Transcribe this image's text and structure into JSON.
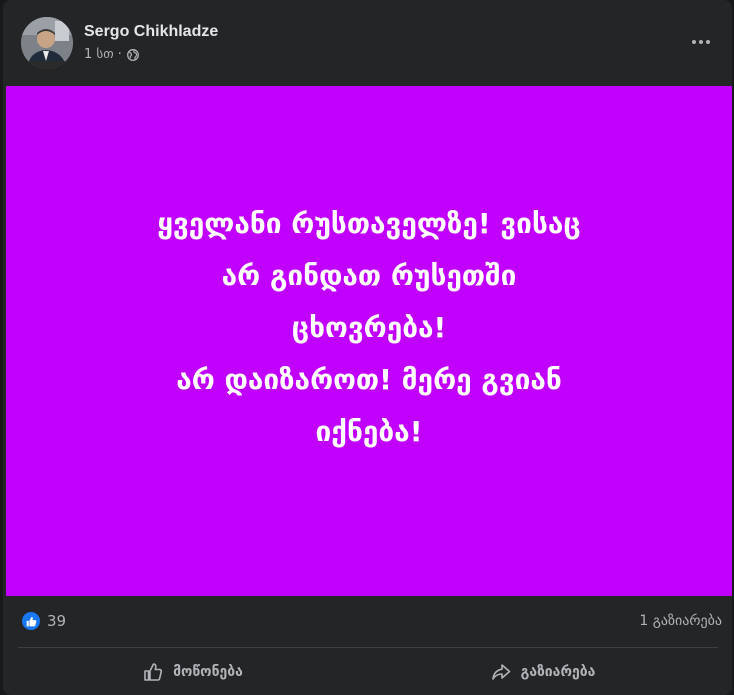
{
  "post": {
    "author": "Sergo Chikhladze",
    "timestamp": "1 სთ",
    "separator": "·",
    "privacy_icon": "globe-icon",
    "more_icon": "more-options-icon",
    "banner": {
      "background": "#c000fc",
      "text_color": "#ffffff",
      "lines": [
        "ყველანი რუსთაველზე! ვისაც",
        "არ გინდათ რუსეთში",
        "ცხოვრება!",
        "არ დაიზაროთ! მერე გვიან",
        "იქნება!"
      ]
    }
  },
  "stats": {
    "reaction_icon": "like-reaction-icon",
    "reactions_count": "39",
    "shares": "1 გაზიარება"
  },
  "actions": {
    "like_label": "მოწონება",
    "like_icon": "thumbs-up-icon",
    "share_label": "გაზიარება",
    "share_icon": "share-arrow-icon"
  },
  "colors": {
    "post_background": "#242526",
    "page_background": "#18191a",
    "accent_blue": "#1877f2",
    "secondary_text": "#b0b3b8",
    "primary_text": "#e4e6eb"
  }
}
